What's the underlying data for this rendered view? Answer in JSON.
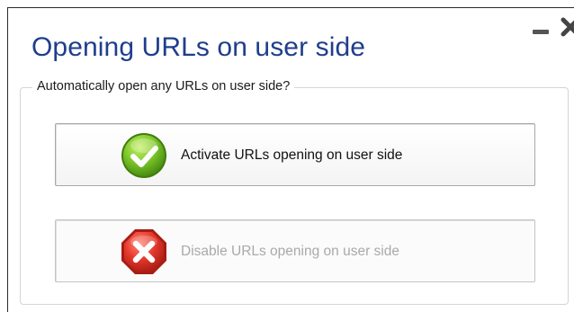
{
  "window": {
    "title": "Opening URLs on user side",
    "accent_color": "#1f3e8c"
  },
  "titlebar": {
    "minimize_icon": "minimize-icon",
    "close_icon": "close-icon"
  },
  "group": {
    "legend": "Automatically open any URLs on user side?"
  },
  "options": [
    {
      "label": "Activate URLs opening on user side",
      "icon": "checkmark-icon",
      "icon_color": "#6cb81e",
      "enabled": true
    },
    {
      "label": "Disable URLs opening on user side",
      "icon": "stop-x-icon",
      "icon_color": "#e0302a",
      "enabled": false
    }
  ]
}
